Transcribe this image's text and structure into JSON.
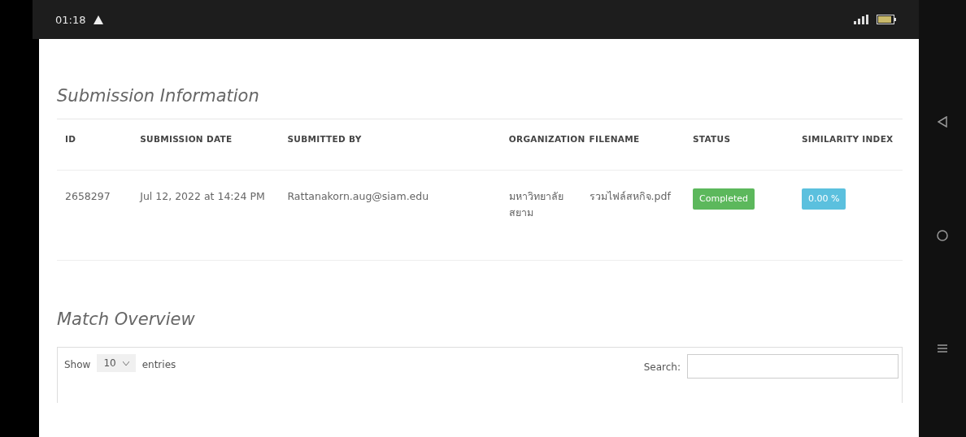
{
  "status_bar": {
    "time": "01:18"
  },
  "submission_information": {
    "title": "Submission Information",
    "columns": [
      "ID",
      "SUBMISSION DATE",
      "SUBMITTED BY",
      "ORGANIZATION",
      "FILENAME",
      "STATUS",
      "SIMILARITY INDEX"
    ],
    "rows": [
      {
        "id": "2658297",
        "submission_date": "Jul 12, 2022 at 14:24 PM",
        "submitted_by": "Rattanakorn.aug@siam.edu",
        "organization": "มหาวิทยาลัยสยาม",
        "filename": "รวมไฟล์สหกิจ.pdf",
        "status": "Completed",
        "similarity_index": "0.00 %"
      }
    ]
  },
  "match_overview": {
    "title": "Match Overview",
    "show_label": "Show",
    "entries_select": "10",
    "entries_label": "entries",
    "search_label": "Search:"
  }
}
